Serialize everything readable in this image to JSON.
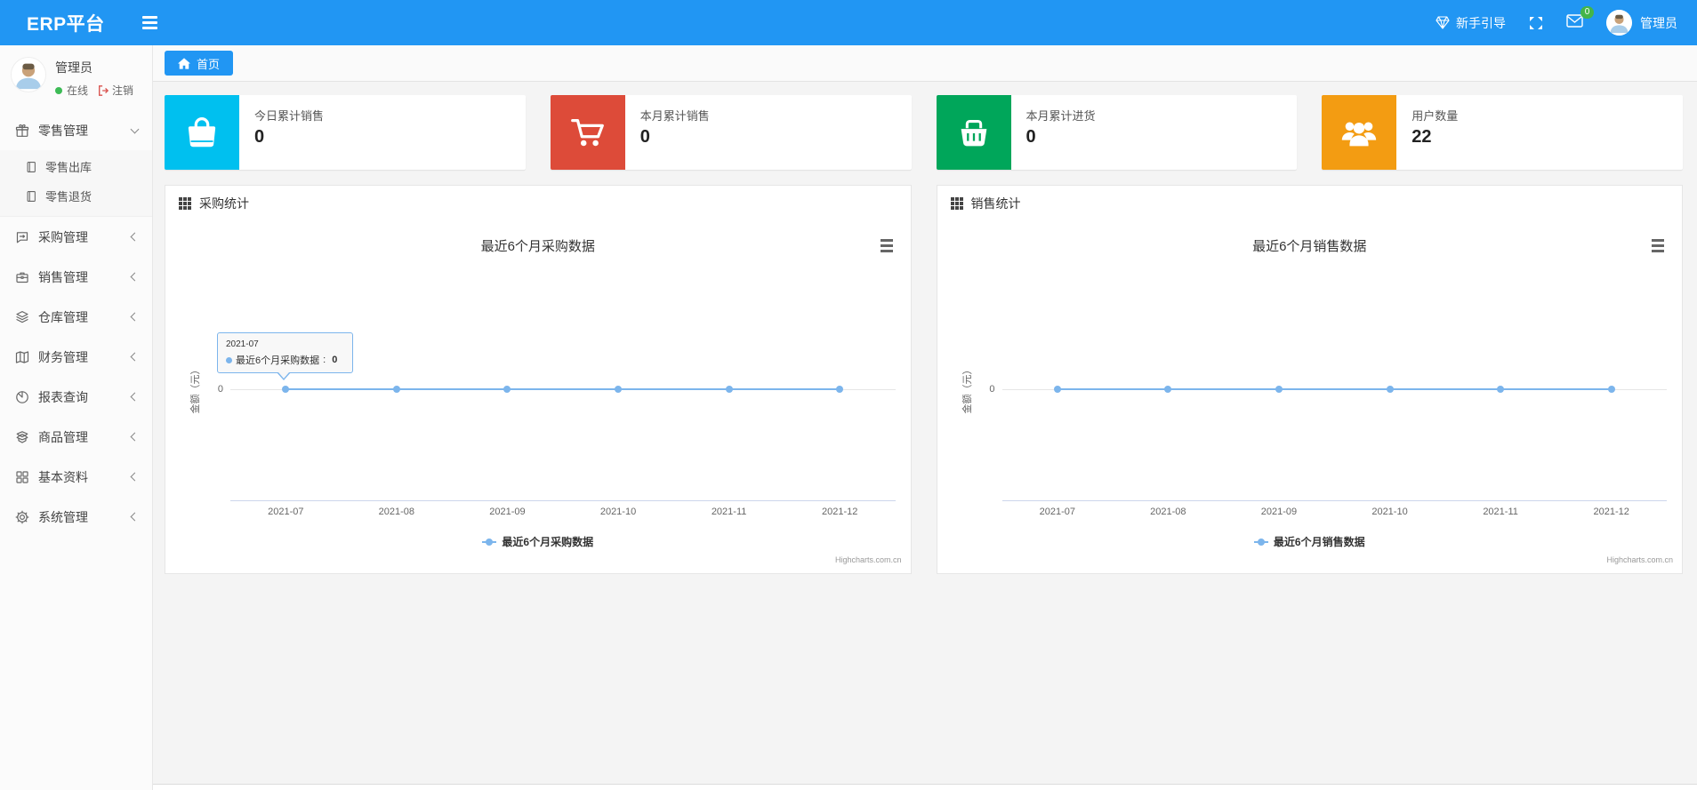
{
  "navbar": {
    "brand": "ERP平台",
    "guide_label": "新手引导",
    "message_badge": "0",
    "user_name": "管理员"
  },
  "sidebar": {
    "user": {
      "name": "管理员",
      "status": "在线",
      "logout_label": "注销"
    },
    "menu": [
      {
        "label": "零售管理",
        "icon": "gift-icon",
        "state": "expanded",
        "children": [
          {
            "label": "零售出库"
          },
          {
            "label": "零售退货"
          }
        ]
      },
      {
        "label": "采购管理",
        "icon": "chat-icon",
        "state": "collapsed"
      },
      {
        "label": "销售管理",
        "icon": "briefcase-icon",
        "state": "collapsed"
      },
      {
        "label": "仓库管理",
        "icon": "layers-icon",
        "state": "collapsed"
      },
      {
        "label": "财务管理",
        "icon": "map-book-icon",
        "state": "collapsed"
      },
      {
        "label": "报表查询",
        "icon": "pie-chart-icon",
        "state": "collapsed"
      },
      {
        "label": "商品管理",
        "icon": "box-icon",
        "state": "collapsed"
      },
      {
        "label": "基本资料",
        "icon": "grid-icon",
        "state": "collapsed"
      },
      {
        "label": "系统管理",
        "icon": "gear-icon",
        "state": "collapsed"
      }
    ]
  },
  "breadcrumb": {
    "home_tab": "首页"
  },
  "stat_cards": [
    {
      "label": "今日累计销售",
      "value": "0",
      "color": "#00c0ef",
      "icon": "shopping-bag-icon"
    },
    {
      "label": "本月累计销售",
      "value": "0",
      "color": "#dd4b39",
      "icon": "shopping-cart-icon"
    },
    {
      "label": "本月累计进货",
      "value": "0",
      "color": "#00a65a",
      "icon": "shopping-basket-icon"
    },
    {
      "label": "用户数量",
      "value": "22",
      "color": "#f39c12",
      "icon": "users-icon"
    }
  ],
  "chart_data": [
    {
      "type": "line",
      "panel_title": "采购统计",
      "title": "最近6个月采购数据",
      "categories": [
        "2021-07",
        "2021-08",
        "2021-09",
        "2021-10",
        "2021-11",
        "2021-12"
      ],
      "series": [
        {
          "name": "最近6个月采购数据",
          "values": [
            0,
            0,
            0,
            0,
            0,
            0
          ],
          "color": "#7cb5ec"
        }
      ],
      "ylabel": "金额（元）",
      "yticks": [
        "0"
      ],
      "ylim": [
        -1,
        1
      ],
      "grid": true,
      "legend_position": "bottom",
      "credits": "Highcharts.com.cn",
      "tooltip": {
        "header": "2021-07",
        "series": "最近6个月采购数据",
        "value": "0"
      }
    },
    {
      "type": "line",
      "panel_title": "销售统计",
      "title": "最近6个月销售数据",
      "categories": [
        "2021-07",
        "2021-08",
        "2021-09",
        "2021-10",
        "2021-11",
        "2021-12"
      ],
      "series": [
        {
          "name": "最近6个月销售数据",
          "values": [
            0,
            0,
            0,
            0,
            0,
            0
          ],
          "color": "#7cb5ec"
        }
      ],
      "ylabel": "金额（元）",
      "yticks": [
        "0"
      ],
      "ylim": [
        -1,
        1
      ],
      "grid": true,
      "legend_position": "bottom",
      "credits": "Highcharts.com.cn"
    }
  ]
}
